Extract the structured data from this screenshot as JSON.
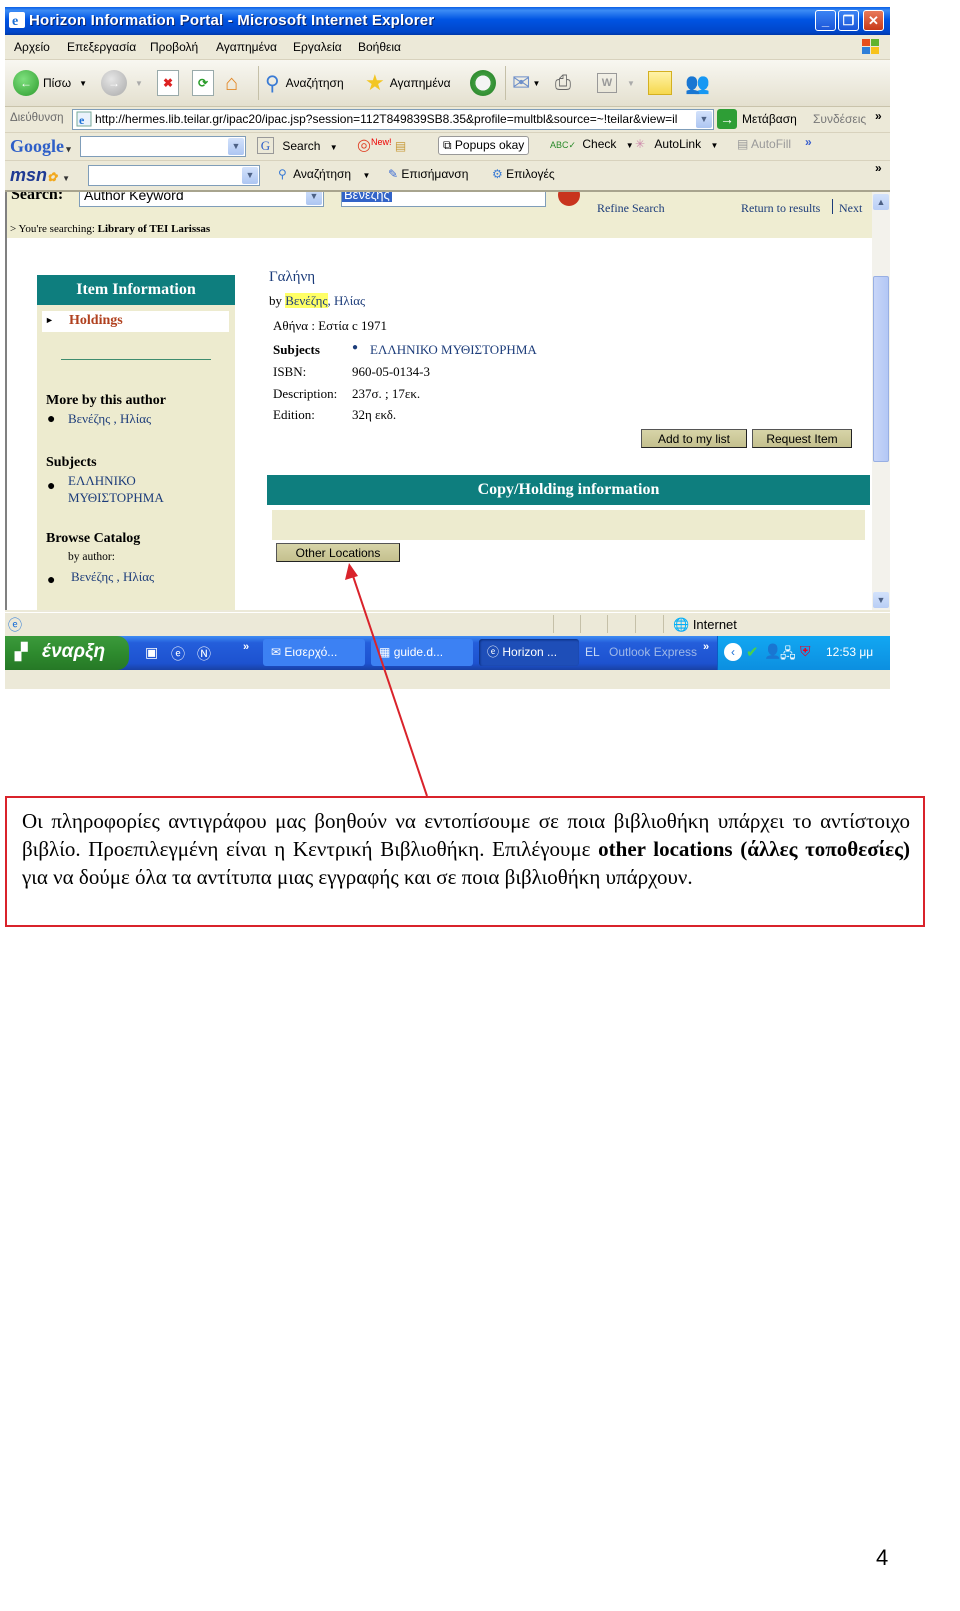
{
  "window": {
    "title": "Horizon Information Portal - Microsoft Internet Explorer",
    "controls": [
      "minimize",
      "restore",
      "close"
    ]
  },
  "menubar": {
    "items": [
      "Αρχείο",
      "Επεξεργασία",
      "Προβολή",
      "Αγαπημένα",
      "Εργαλεία",
      "Βοήθεια"
    ]
  },
  "toolbar": {
    "back_label": "Πίσω",
    "search_label": "Αναζήτηση",
    "favorites_label": "Αγαπημένα"
  },
  "addressbar": {
    "label": "Διεύθυνση",
    "url": "http://hermes.lib.teilar.gr/ipac20/ipac.jsp?session=112T849839SB8.35&profile=multbl&source=~!teilar&view=il",
    "go_label": "Μετάβαση",
    "links_label": "Συνδέσεις"
  },
  "googlebar": {
    "brand": "Google",
    "search_label": "Search",
    "new_badge": "New!",
    "popups_label": "Popups okay",
    "check_label": "Check",
    "autolink_label": "AutoLink",
    "autofill_label": "AutoFill"
  },
  "msnbar": {
    "brand": "msn",
    "search_label": "Αναζήτηση",
    "highlight_label": "Επισήμανση",
    "options_label": "Επιλογές"
  },
  "page": {
    "search": {
      "label": "Search:",
      "type_value": "Author Keyword",
      "term_value": "Βενέζης",
      "refine_label": "Refine Search",
      "return_label": "Return to results",
      "next_label": "Next"
    },
    "searching_prefix": "> You're searching:",
    "searching_library": "Library of TEI Larissas",
    "sidebar": {
      "header": "Item Information",
      "holdings_label": "Holdings",
      "more_by_author_heading": "More by this author",
      "more_by_author_link": "Βενέζης , Ηλίας",
      "subjects_heading": "Subjects",
      "subjects_link_line1": "ΕΛΛΗΝΙΚΟ",
      "subjects_link_line2": "ΜΥΘΙΣΤΟΡΗΜΑ",
      "browse_heading": "Browse Catalog",
      "browse_by": "by author:",
      "browse_link": "Βενέζης , Ηλίας"
    },
    "item": {
      "title": "Γαλήνη",
      "by_prefix": "by",
      "author_surname": "Βενέζης",
      "author_rest": ", Ηλίας",
      "publication": "Αθήνα : Εστία c 1971",
      "fields": [
        {
          "label": "Subjects",
          "value": "ΕΛΛΗΝΙΚΟ ΜΥΘΙΣΤΟΡΗΜΑ"
        },
        {
          "label": "ISBN:",
          "value": "960-05-0134-3"
        },
        {
          "label": "Description:",
          "value": "237σ. ; 17εκ."
        },
        {
          "label": "Edition:",
          "value": "32η εκδ."
        }
      ],
      "add_to_list_label": "Add to my list",
      "request_item_label": "Request Item"
    },
    "copy_holding_header": "Copy/Holding information",
    "other_locations_label": "Other Locations"
  },
  "statusbar": {
    "zone_label": "Internet"
  },
  "taskbar": {
    "start_label": "έναρξη",
    "tasks": [
      "Εισερχό...",
      "guide.d...",
      "Horizon ..."
    ],
    "language": "EL",
    "outlook_label": "Outlook Express",
    "clock": "12:53 μμ"
  },
  "callout": {
    "text_before_bold1": "Οι πληροφορίες αντιγράφου μας βοηθούν να εντοπίσουμε σε ποια βιβλιοθήκη υπάρχει το αντίστοιχο βιβλίο. Προεπιλεγμένη είναι η Κεντρική Βιβλιοθήκη. Επιλέγουμε ",
    "bold1": "other locations",
    "space": " ",
    "bold2": "(άλλες τοποθεσίες)",
    "text_after": " για να δούμε όλα τα αντίτυπα μιας εγγραφής και σε ποια βιβλιοθήκη υπάρχουν."
  },
  "colors": {
    "teal_header": "#0E7E7E",
    "beige_panel": "#EDEBCF",
    "holdings_red": "#B0401E",
    "callout_border": "#D9232B",
    "arrow": "#D9232B",
    "highlight_yellow": "#FFFF66"
  },
  "page_number": "4"
}
